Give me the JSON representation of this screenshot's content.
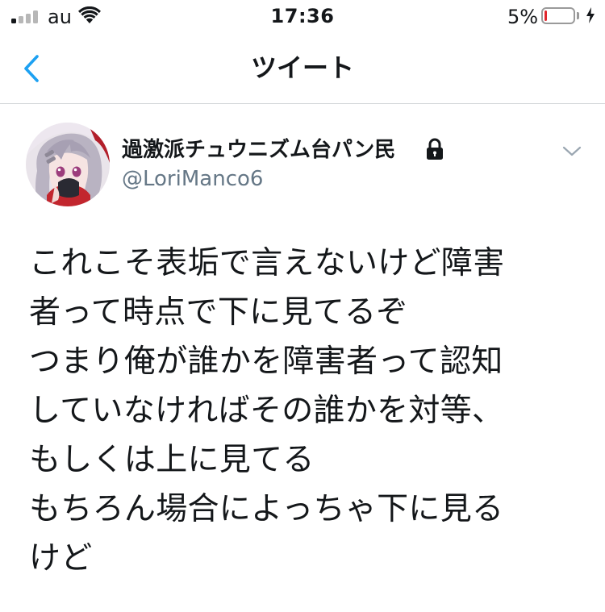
{
  "status_bar": {
    "carrier": "au",
    "time": "17:36",
    "battery_percent": "5%",
    "battery_level": 0.05,
    "signal_bars_active": 1,
    "signal_bars_total": 4
  },
  "nav": {
    "title": "ツイート"
  },
  "tweet": {
    "display_name": "過激派チュウニズム台パン民",
    "handle": "@LoriManco6",
    "protected": true,
    "lines": [
      "これこそ表垢で言えないけど障害",
      "者って時点で下に見てるぞ",
      "つまり俺が誰かを障害者って認知",
      "していなければその誰かを対等、",
      "もしくは上に見てる",
      "もちろん場合によっちゃ下に見る",
      "けど"
    ]
  },
  "colors": {
    "accent": "#1da1f2",
    "text": "#14171a",
    "secondary_text": "#657786",
    "battery_low": "#e0262c",
    "divider": "#d3d6d9"
  },
  "icons": {
    "back": "chevron-left-icon",
    "lock": "lock-icon",
    "caret": "chevron-down-icon",
    "wifi": "wifi-icon",
    "charging": "bolt-icon"
  }
}
